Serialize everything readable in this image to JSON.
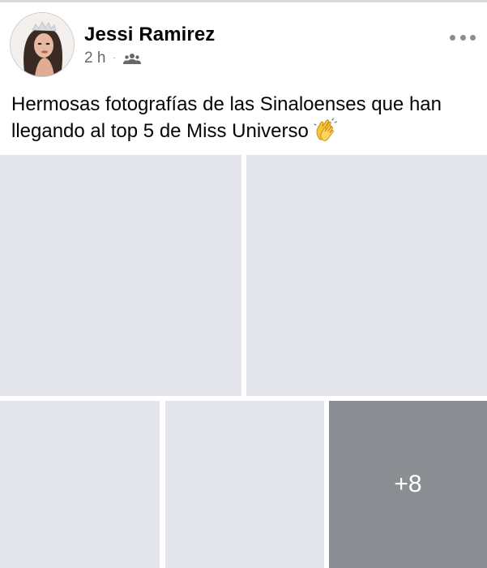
{
  "post": {
    "author": "Jessi Ramirez",
    "time": "2 h",
    "separator": "·",
    "audience_icon": "friends-icon",
    "text": "Hermosas fotografías de las Sinaloenses que han llegando al top 5 de Miss Universo",
    "emoji": "clapping-hands-icon"
  },
  "gallery": {
    "more_count": "+8",
    "placeholder_color": "#e4e6eb",
    "overlay_color": "#8a8d91"
  },
  "colors": {
    "secondary_text": "#65676b",
    "primary_text": "#050505"
  }
}
